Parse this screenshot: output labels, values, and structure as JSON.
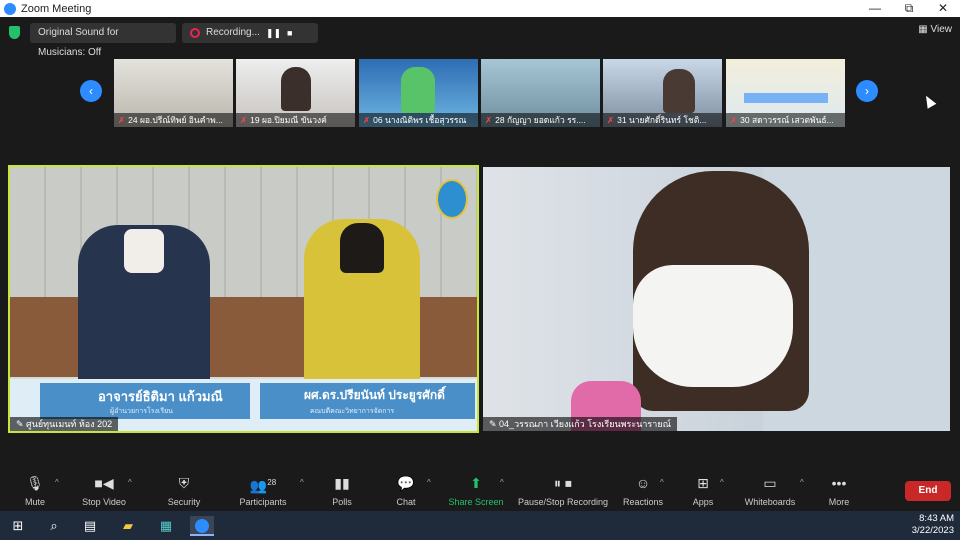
{
  "window": {
    "title": "Zoom Meeting",
    "minimize": "—",
    "restore": "⧉",
    "close": "✕"
  },
  "topbar": {
    "sound_label": "Original Sound for Musicians: Off",
    "recording_label": "Recording...",
    "pause_glyph": "❚❚",
    "stop_glyph": "■",
    "view_label": "View"
  },
  "strip": {
    "prev_glyph": "‹",
    "next_glyph": "›",
    "participants": [
      {
        "name": "24 ผอ.ปรีณ์ทิพย์ อินคำพ..."
      },
      {
        "name": "19 ผอ.ปิยมณี ขันวงค์"
      },
      {
        "name": "06 นางณิติพร เชื้อสุวรรณ"
      },
      {
        "name": "28 กัญญา ยอดแก้ว รร...."
      },
      {
        "name": "31 นายศักดิ์รินทร์ โชติ..."
      },
      {
        "name": "30 สดาวรรณ์ เสวตพันธ์..."
      }
    ]
  },
  "tiles": {
    "main": {
      "name": "ศูนย์ทุนเมนท์ ห้อง 202",
      "banner_left_name": "อาจารย์ธิติมา แก้วมณี",
      "banner_left_sub": "ผู้อำนวยการโรงเรียน",
      "banner_right_name": "ผศ.ดร.ปรียนันท์ ประยูรศักดิ์",
      "banner_right_sub": "คณบดีคณะวิทยาการจัดการ"
    },
    "second": {
      "name": "04_วรรณภา เวียงแก้ว โรงเรียนพระนารายณ์"
    }
  },
  "toolbar": {
    "mute": "Mute",
    "stop_video": "Stop Video",
    "security": "Security",
    "participants": "Participants",
    "participants_count": "28",
    "polls": "Polls",
    "chat": "Chat",
    "share_screen": "Share Screen",
    "pause_stop_recording": "Pause/Stop Recording",
    "reactions": "Reactions",
    "apps": "Apps",
    "whiteboards": "Whiteboards",
    "more": "More",
    "end": "End"
  },
  "taskbar": {
    "time": "8:43 AM",
    "date": "3/22/2023"
  },
  "colors": {
    "accent": "#2d8cff",
    "active_speaker": "#c6e63a",
    "end": "#c82828",
    "share": "#23c16b"
  },
  "icons": [
    "zoom-logo-icon",
    "shield-icon",
    "record-icon",
    "view-icon",
    "mic-icon",
    "video-icon",
    "security-icon",
    "participants-icon",
    "polls-icon",
    "chat-icon",
    "share-screen-icon",
    "record-control-icon",
    "reactions-icon",
    "apps-icon",
    "whiteboards-icon",
    "more-icon",
    "windows-start-icon",
    "search-icon",
    "task-view-icon",
    "file-explorer-icon",
    "store-icon",
    "zoom-taskbar-icon"
  ]
}
